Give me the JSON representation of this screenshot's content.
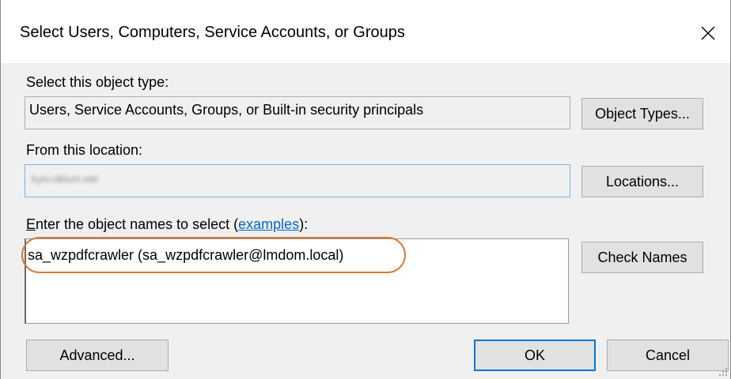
{
  "window": {
    "title": "Select Users, Computers, Service Accounts, or Groups"
  },
  "object_type": {
    "label": "Select this object type:",
    "value": "Users, Service Accounts, Groups, or Built-in security principals",
    "button": "Object Types..."
  },
  "location": {
    "label": "From this location:",
    "value": "kyiv.ciklum.net",
    "button": "Locations..."
  },
  "names": {
    "label_prefix_underlined": "E",
    "label_middle": "nter the object names to select (",
    "label_link": "examples",
    "label_suffix": "):",
    "value": "sa_wzpdfcrawler (sa_wzpdfcrawler@lmdom.local)",
    "button": "Check Names"
  },
  "footer": {
    "advanced_button": "Advanced...",
    "ok_button": "OK",
    "cancel_button": "Cancel"
  },
  "colors": {
    "highlight": "#d7782f",
    "link": "#0066cc",
    "default_button_border": "#0078d7"
  }
}
